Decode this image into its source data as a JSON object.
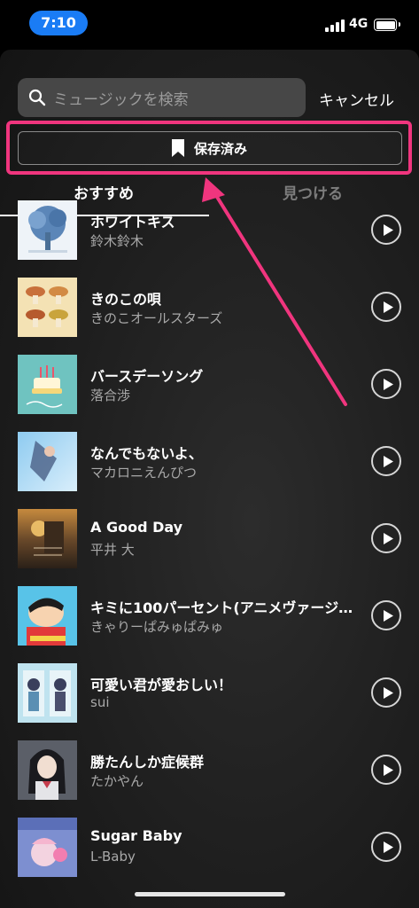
{
  "status": {
    "time": "7:10",
    "network": "4G"
  },
  "search": {
    "placeholder": "ミュージックを検索",
    "cancel_label": "キャンセル"
  },
  "saved": {
    "label": "保存済み"
  },
  "tabs": [
    {
      "label": "おすすめ"
    },
    {
      "label": "見つける"
    }
  ],
  "songs": [
    {
      "title": "ホワイトキス",
      "artist": "鈴木鈴木"
    },
    {
      "title": "きのこの唄",
      "artist": "きのこオールスターズ"
    },
    {
      "title": "バースデーソング",
      "artist": "落合渉"
    },
    {
      "title": "なんでもないよ、",
      "artist": "マカロニえんぴつ"
    },
    {
      "title": "A Good Day",
      "artist": "平井 大"
    },
    {
      "title": "キミに100パーセント(アニメヴァージ…",
      "artist": "きゃりーぱみゅぱみゅ"
    },
    {
      "title": "可愛い君が愛おしい！",
      "artist": "sui"
    },
    {
      "title": "勝たんしか症候群",
      "artist": "たかやん"
    },
    {
      "title": "Sugar Baby",
      "artist": "L-Baby"
    }
  ],
  "colors": {
    "highlight": "#f0357e",
    "time_pill": "#1a7cf5"
  }
}
